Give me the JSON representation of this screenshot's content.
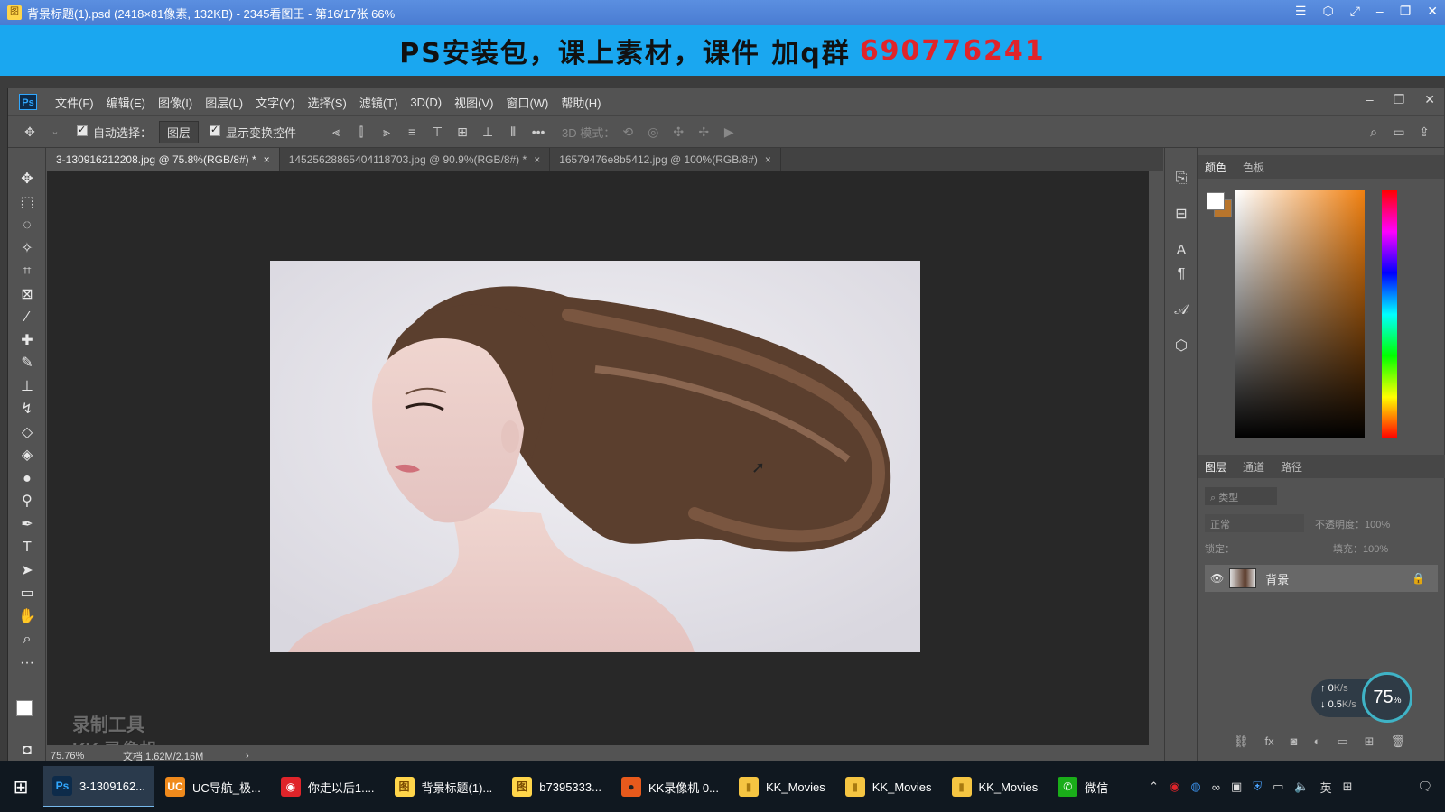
{
  "viewer": {
    "title": "背景标题(1).psd  (2418×81像素, 132KB)  - 2345看图王 - 第16/17张 66%",
    "icon": "image-viewer-icon",
    "controls": [
      "☰",
      "⬡",
      "⤢",
      "–",
      "❐",
      "✕"
    ]
  },
  "banner": {
    "text": "PS安装包，课上素材，课件 加q群",
    "qq": "690776241",
    "qq_color": "#e0242a"
  },
  "photoshop": {
    "logo": "Ps",
    "menu": [
      "文件(F)",
      "编辑(E)",
      "图像(I)",
      "图层(L)",
      "文字(Y)",
      "选择(S)",
      "滤镜(T)",
      "3D(D)",
      "视图(V)",
      "窗口(W)",
      "帮助(H)"
    ],
    "options": {
      "auto_select_label": "自动选择：",
      "auto_select_value": "图层",
      "show_transform_label": "显示变换控件",
      "mode_3d_label": "3D 模式："
    },
    "tabs": [
      {
        "label": "3-130916212208.jpg @ 75.8%(RGB/8#) *",
        "close": "×"
      },
      {
        "label": "14525628865404118703.jpg @ 90.9%(RGB/8#) *",
        "close": "×"
      },
      {
        "label": "16579476e8b5412.jpg @ 100%(RGB/8#)",
        "close": "×"
      }
    ],
    "status": {
      "zoom": "75.76%",
      "doc": "文档:1.62M/2.16M",
      "arrow": "›"
    },
    "watermark": {
      "line1": "录制工具",
      "line2": "KK 录像机"
    },
    "color_panel": {
      "tabs": [
        "颜色",
        "色板"
      ],
      "fg_color": "#ffffff",
      "bg_color": "#b8752c"
    },
    "layers_panel": {
      "tabs": [
        "图层",
        "通道",
        "路径"
      ],
      "filter_placeholder": "类型",
      "blend_mode": "正常",
      "opacity_label": "不透明度：",
      "opacity_value": "100%",
      "lock_label": "锁定：",
      "fill_label": "填充：",
      "fill_value": "100%",
      "layer_name": "背景"
    },
    "net_widget": {
      "up": "0",
      "up_unit": "K/s",
      "down": "0.5",
      "down_unit": "K/s",
      "cpu": "75",
      "cpu_unit": "%"
    }
  },
  "taskbar": {
    "items": [
      {
        "label": "3-1309162...",
        "icon": "Ps",
        "color": "#0d2b4a",
        "fg": "#31a8ff",
        "active": true
      },
      {
        "label": "UC导航_极...",
        "icon": "UC",
        "color": "#f08a1c",
        "fg": "#fff"
      },
      {
        "label": "你走以后1....",
        "icon": "◉",
        "color": "#e0242a",
        "fg": "#fff"
      },
      {
        "label": "背景标题(1)...",
        "icon": "图",
        "color": "#ffd54a",
        "fg": "#7a4a00"
      },
      {
        "label": "b7395333...",
        "icon": "图",
        "color": "#ffd54a",
        "fg": "#7a4a00"
      },
      {
        "label": "KK录像机 0...",
        "icon": "●",
        "color": "#e85a1c",
        "fg": "#222"
      },
      {
        "label": "KK_Movies",
        "icon": "▮",
        "color": "#f5c542",
        "fg": "#a87a10"
      },
      {
        "label": "KK_Movies",
        "icon": "▮",
        "color": "#f5c542",
        "fg": "#a87a10"
      },
      {
        "label": "KK_Movies",
        "icon": "▮",
        "color": "#f5c542",
        "fg": "#a87a10"
      },
      {
        "label": "微信",
        "icon": "✆",
        "color": "#1aad19",
        "fg": "#fff"
      }
    ],
    "lang": "英"
  }
}
